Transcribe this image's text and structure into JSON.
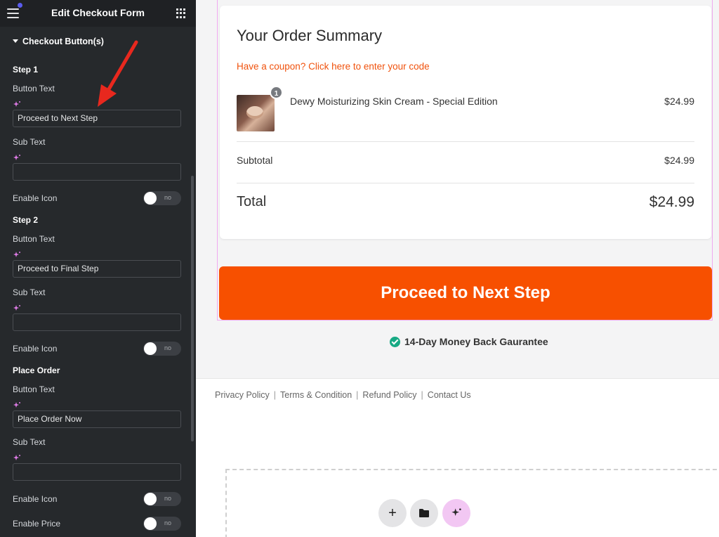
{
  "panel": {
    "title": "Edit Checkout Form",
    "section": "Checkout Button(s)",
    "step1": {
      "heading": "Step 1",
      "button_text_label": "Button Text",
      "button_text_value": "Proceed to Next Step",
      "sub_text_label": "Sub Text",
      "sub_text_value": "",
      "enable_icon_label": "Enable Icon",
      "enable_icon_state": "no"
    },
    "step2": {
      "heading": "Step 2",
      "button_text_label": "Button Text",
      "button_text_value": "Proceed to Final Step",
      "sub_text_label": "Sub Text",
      "sub_text_value": "",
      "enable_icon_label": "Enable Icon",
      "enable_icon_state": "no"
    },
    "place_order": {
      "heading": "Place Order",
      "button_text_label": "Button Text",
      "button_text_value": "Place Order Now",
      "sub_text_label": "Sub Text",
      "sub_text_value": "",
      "enable_icon_label": "Enable Icon",
      "enable_icon_state": "no",
      "enable_price_label": "Enable Price",
      "enable_price_state": "no"
    }
  },
  "preview": {
    "summary_title": "Your Order Summary",
    "coupon_link": "Have a coupon? Click here to enter your code",
    "product": {
      "quantity": "1",
      "name": "Dewy Moisturizing Skin Cream - Special Edition",
      "price": "$24.99"
    },
    "subtotal_label": "Subtotal",
    "subtotal_value": "$24.99",
    "total_label": "Total",
    "total_value": "$24.99",
    "next_button": "Proceed to Next Step",
    "guarantee": "14-Day Money Back Gaurantee",
    "footer_links": [
      "Privacy Policy",
      "Terms & Condition",
      "Refund Policy",
      "Contact Us"
    ],
    "fab_add": "+"
  },
  "colors": {
    "accent_orange": "#f75000",
    "coupon_orange": "#f0520d",
    "panel_bg": "#26292c",
    "check_green": "#17a984",
    "ai_pink": "#f2c7f3",
    "annotation_red": "#e8281e"
  },
  "icons": [
    "hamburger-menu-icon",
    "apps-grid-icon",
    "ai-sparkle-icon",
    "chevron-left-icon",
    "check-circle-icon",
    "plus-icon",
    "folder-icon"
  ]
}
